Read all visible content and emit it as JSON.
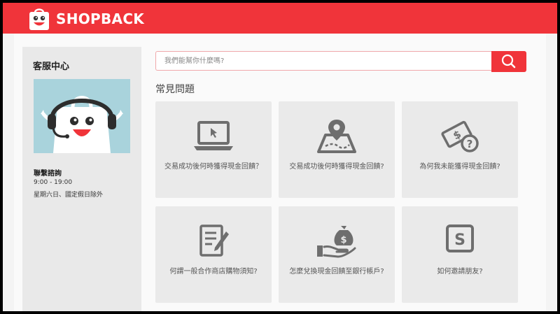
{
  "header": {
    "brand": "SHOPBACK",
    "color": "#f0343a"
  },
  "sidebar": {
    "title": "客服中心",
    "contact_label": "聯繫諮詢",
    "hours": "9:00 - 19:00",
    "days_note": "星期六日、國定假日除外"
  },
  "search": {
    "placeholder": "我們能幫你什麼嗎?",
    "value": "",
    "icon": "search-icon"
  },
  "faq": {
    "title": "常見問題",
    "cards": [
      {
        "label": "交易成功後何時獲得現金回饋？",
        "icon": "laptop-icon"
      },
      {
        "label": "交易成功後何時獲得現金回饋?",
        "icon": "map-pin-icon"
      },
      {
        "label": "為何我未能獲得現金回饋?",
        "icon": "money-question-icon"
      },
      {
        "label": "何謂一般合作商店購物須知?",
        "icon": "document-pen-icon"
      },
      {
        "label": "怎麼兌換現金回饋至銀行帳戶?",
        "icon": "money-bag-hand-icon"
      },
      {
        "label": "如何邀請朋友?",
        "icon": "shopback-s-icon"
      }
    ]
  }
}
